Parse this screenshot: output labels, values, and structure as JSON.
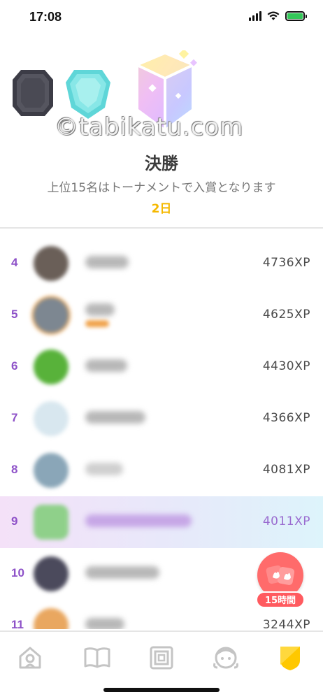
{
  "status_bar": {
    "time": "17:08"
  },
  "watermark": {
    "text": "©tabikatu.com"
  },
  "league": {
    "title": "決勝",
    "subtitle": "上位15名はトーナメントで入賞となります",
    "days_left": "2日"
  },
  "ranking": {
    "rows": [
      {
        "rank": "4",
        "xp": "4736XP",
        "avatar_color": "#6a5f58",
        "is_me": false
      },
      {
        "rank": "5",
        "xp": "4625XP",
        "avatar_color": "#7d8791",
        "is_me": false
      },
      {
        "rank": "6",
        "xp": "4430XP",
        "avatar_color": "#58b23a",
        "is_me": false
      },
      {
        "rank": "7",
        "xp": "4366XP",
        "avatar_color": "#d8e7ef",
        "is_me": false
      },
      {
        "rank": "8",
        "xp": "4081XP",
        "avatar_color": "#8aa6b8",
        "is_me": false
      },
      {
        "rank": "9",
        "xp": "4011XP",
        "avatar_color": "#8fd08a",
        "is_me": true
      },
      {
        "rank": "10",
        "xp": "",
        "avatar_color": "#4b4a5c",
        "is_me": false
      },
      {
        "rank": "11",
        "xp": "3244XP",
        "avatar_color": "#e9a760",
        "is_me": false
      }
    ]
  },
  "timer": {
    "label": "15時間"
  },
  "nav": {
    "items": [
      {
        "icon": "home-icon"
      },
      {
        "icon": "book-icon"
      },
      {
        "icon": "stories-icon"
      },
      {
        "icon": "character-icon"
      },
      {
        "icon": "league-shield-icon",
        "active": true
      }
    ]
  },
  "colors": {
    "accent_purple": "#8e52c8",
    "gold": "#f5b800",
    "timer_red": "#ff5a5f"
  }
}
